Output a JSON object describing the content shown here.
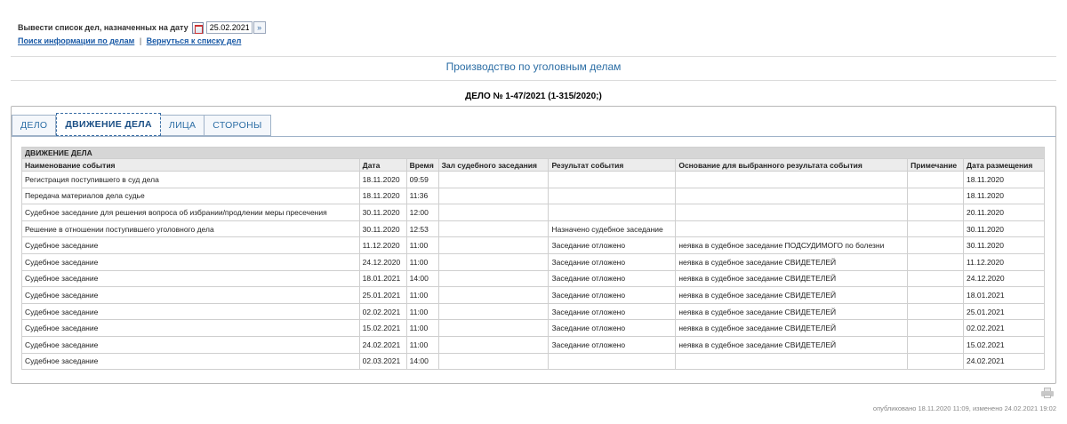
{
  "filter": {
    "label": "Вывести список дел, назначенных на дату",
    "date_value": "25.02.2021",
    "go_label": "»"
  },
  "links": {
    "search": "Поиск информации по делам",
    "separator": "|",
    "back": "Вернуться к списку дел"
  },
  "section_title": "Производство по уголовным делам",
  "case_title": "ДЕЛО № 1-47/2021 (1-315/2020;)",
  "tabs": [
    {
      "label": "ДЕЛО"
    },
    {
      "label": "ДВИЖЕНИЕ ДЕЛА"
    },
    {
      "label": "ЛИЦА"
    },
    {
      "label": "СТОРОНЫ"
    }
  ],
  "table": {
    "caption": "ДВИЖЕНИЕ ДЕЛА",
    "headers": [
      "Наименование события",
      "Дата",
      "Время",
      "Зал судебного заседания",
      "Результат события",
      "Основание для выбранного результата события",
      "Примечание",
      "Дата размещения"
    ],
    "rows": [
      [
        "Регистрация поступившего в суд дела",
        "18.11.2020",
        "09:59",
        "",
        "",
        "",
        "",
        "18.11.2020"
      ],
      [
        "Передача материалов дела судье",
        "18.11.2020",
        "11:36",
        "",
        "",
        "",
        "",
        "18.11.2020"
      ],
      [
        "Судебное заседание для решения вопроса об избрании/продлении меры пресечения",
        "30.11.2020",
        "12:00",
        "",
        "",
        "",
        "",
        "20.11.2020"
      ],
      [
        "Решение в отношении поступившего уголовного дела",
        "30.11.2020",
        "12:53",
        "",
        "Назначено судебное заседание",
        "",
        "",
        "30.11.2020"
      ],
      [
        "Судебное заседание",
        "11.12.2020",
        "11:00",
        "",
        "Заседание отложено",
        "неявка в судебное заседание ПОДСУДИМОГО по болезни",
        "",
        "30.11.2020"
      ],
      [
        "Судебное заседание",
        "24.12.2020",
        "11:00",
        "",
        "Заседание отложено",
        "неявка в судебное заседание СВИДЕТЕЛЕЙ",
        "",
        "11.12.2020"
      ],
      [
        "Судебное заседание",
        "18.01.2021",
        "14:00",
        "",
        "Заседание отложено",
        "неявка в судебное заседание СВИДЕТЕЛЕЙ",
        "",
        "24.12.2020"
      ],
      [
        "Судебное заседание",
        "25.01.2021",
        "11:00",
        "",
        "Заседание отложено",
        "неявка в судебное заседание СВИДЕТЕЛЕЙ",
        "",
        "18.01.2021"
      ],
      [
        "Судебное заседание",
        "02.02.2021",
        "11:00",
        "",
        "Заседание отложено",
        "неявка в судебное заседание СВИДЕТЕЛЕЙ",
        "",
        "25.01.2021"
      ],
      [
        "Судебное заседание",
        "15.02.2021",
        "11:00",
        "",
        "Заседание отложено",
        "неявка в судебное заседание СВИДЕТЕЛЕЙ",
        "",
        "02.02.2021"
      ],
      [
        "Судебное заседание",
        "24.02.2021",
        "11:00",
        "",
        "Заседание отложено",
        "неявка в судебное заседание СВИДЕТЕЛЕЙ",
        "",
        "15.02.2021"
      ],
      [
        "Судебное заседание",
        "02.03.2021",
        "14:00",
        "",
        "",
        "",
        "",
        "24.02.2021"
      ]
    ]
  },
  "footer": {
    "published": "опубликовано 18.11.2020 11:09, изменено 24.02.2021 19:02"
  },
  "icons": {
    "calendar": "calendar-icon",
    "printer": "printer-icon"
  }
}
